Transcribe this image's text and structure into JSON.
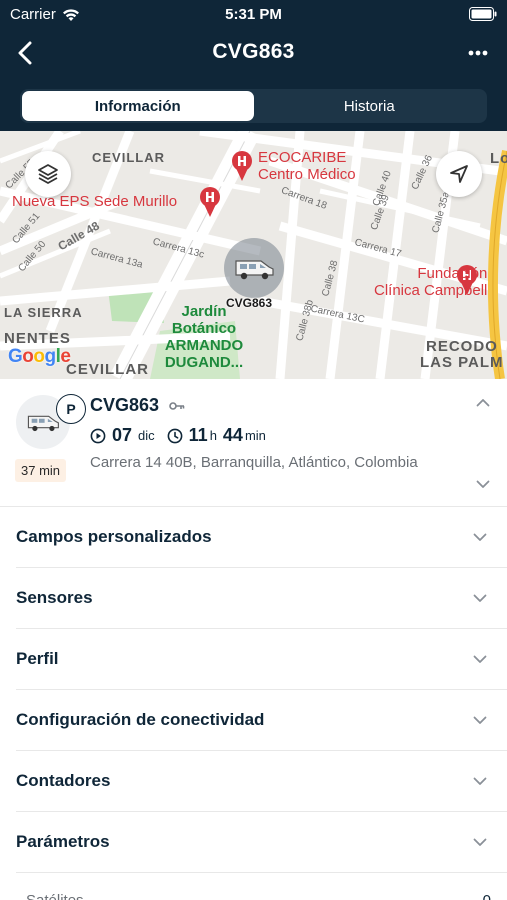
{
  "status_bar": {
    "carrier": "Carrier",
    "time": "5:31 PM"
  },
  "nav": {
    "title": "CVG863",
    "back_icon": "chevron-left-icon",
    "more_icon": "more-horizontal-icon"
  },
  "tabs": [
    {
      "label": "Información",
      "active": true
    },
    {
      "label": "Historia",
      "active": false
    }
  ],
  "map": {
    "areas": {
      "cevillar_top": "CEVILLAR",
      "la_sierra": "LA SIERRA",
      "nentes": "NENTES",
      "cevillar_bottom": "CEVILLAR",
      "recodo": "RECODO",
      "las_palm": "LAS PALM"
    },
    "streets": {
      "calle55": "Calle 55",
      "calle51": "Calle 51",
      "calle50": "Calle 50",
      "calle48": "Calle 48",
      "carrera13c_a": "Carrera 13c",
      "carrera13a": "Carrera 13a",
      "carrera18": "Carrera 18",
      "calle36": "Calle 36",
      "calle35a": "Calle 35a",
      "calle40": "Calle 40",
      "calle39": "Calle 39",
      "carrera17": "Carrera 17",
      "calle38b": "Calle 38b",
      "calle38": "Calle 38",
      "carrera13c_b": "Carrera 13C"
    },
    "pois": {
      "ecocaribe_1": "ECOCARIBE",
      "ecocaribe_2": "Centro Médico",
      "eps": "Nueva EPS Sede Murillo",
      "fundacion_1": "Fundación",
      "fundacion_2": "Clínica Campbell",
      "jardin": "Jardín Botánico ARMANDO DUGAND..."
    },
    "edge_label": "Lo",
    "marker_label": "CVG863",
    "google": "Google",
    "layers_icon": "layers-icon",
    "locate_icon": "navigation-arrow-icon"
  },
  "vehicle": {
    "name": "CVG863",
    "status_badge": "P",
    "key_icon": "key-icon",
    "date_day": "07",
    "date_month": "dic",
    "duration_hours": "11",
    "duration_hours_unit": "h",
    "duration_minutes": "44",
    "duration_minutes_unit": "min",
    "address": "Carrera 14 40B, Barranquilla, Atlántico, Colombia",
    "time_badge": "37 min"
  },
  "sections": [
    {
      "title": "Campos personalizados"
    },
    {
      "title": "Sensores"
    },
    {
      "title": "Perfil"
    },
    {
      "title": "Configuración de conectividad"
    },
    {
      "title": "Contadores"
    },
    {
      "title": "Parámetros"
    }
  ],
  "partial_row": {
    "label": "Satélites",
    "value": "0"
  },
  "colors": {
    "header": "#0f2638",
    "poi_red": "#d7373f",
    "park_green": "#1e8a3c",
    "accent": "#0f2638"
  }
}
